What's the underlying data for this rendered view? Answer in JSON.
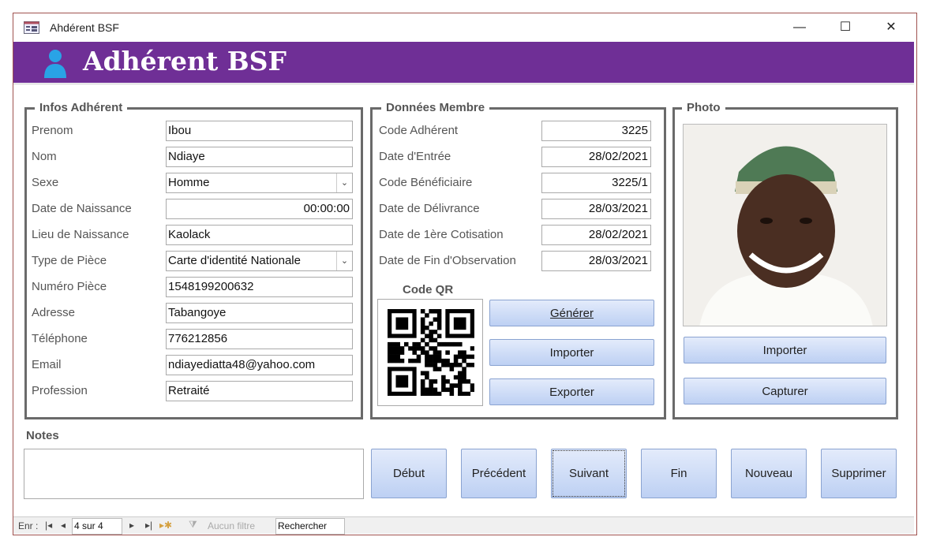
{
  "window": {
    "title": "Ahdérent BSF",
    "minimize": "—",
    "maximize": "☐",
    "close": "✕"
  },
  "header": {
    "title": "Adhérent BSF",
    "accent": "#6f2f96"
  },
  "infos": {
    "legend": "Infos Adhérent",
    "fields": [
      {
        "label": "Prenom",
        "value": "Ibou"
      },
      {
        "label": "Nom",
        "value": "Ndiaye"
      },
      {
        "label": "Sexe",
        "value": "Homme"
      },
      {
        "label": "Date de Naissance",
        "value": "00:00:00"
      },
      {
        "label": "Lieu de Naissance",
        "value": "Kaolack"
      },
      {
        "label": "Type de Pièce",
        "value": "Carte d'identité Nationale"
      },
      {
        "label": "Numéro Pièce",
        "value": "1548199200632"
      },
      {
        "label": "Adresse",
        "value": "Tabangoye"
      },
      {
        "label": "Téléphone",
        "value": "776212856"
      },
      {
        "label": "Email",
        "value": "ndiayediatta48@yahoo.com"
      },
      {
        "label": "Profession",
        "value": "Retraité"
      }
    ]
  },
  "membre": {
    "legend": "Données Membre",
    "fields": [
      {
        "label": "Code Adhérent",
        "value": "3225"
      },
      {
        "label": "Date d'Entrée",
        "value": "28/02/2021"
      },
      {
        "label": "Code Bénéficiaire",
        "value": "3225/1"
      },
      {
        "label": "Date de Délivrance",
        "value": "28/03/2021"
      },
      {
        "label": "Date de 1ère Cotisation",
        "value": "28/02/2021"
      },
      {
        "label": "Date de Fin d'Observation",
        "value": "28/03/2021"
      }
    ],
    "qr_label": "Code QR",
    "buttons": [
      "Générer",
      "Importer",
      "Exporter"
    ]
  },
  "photo": {
    "legend": "Photo",
    "buttons": [
      "Importer",
      "Capturer"
    ]
  },
  "notes": {
    "label": "Notes",
    "value": ""
  },
  "nav": [
    "Début",
    "Précédent",
    "Suivant",
    "Fin",
    "Nouveau",
    "Supprimer"
  ],
  "status": {
    "record_label": "Enr :",
    "record": "4 sur 4",
    "filter": "Aucun filtre",
    "search": "Rechercher"
  }
}
